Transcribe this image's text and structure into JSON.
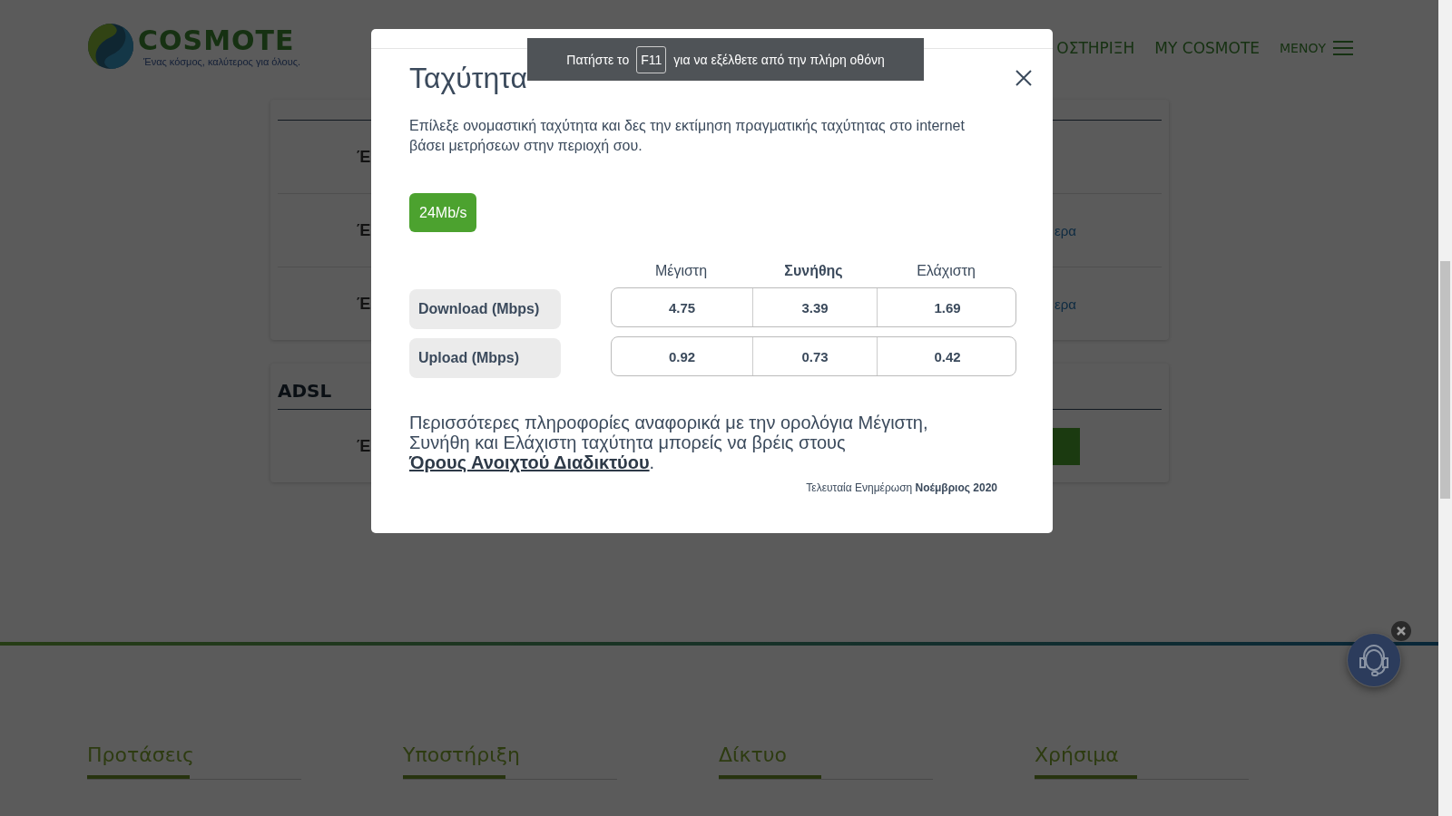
{
  "header": {
    "logo": {
      "name": "COSMOTE",
      "tagline": "Ένας κόσμος, καλύτερος για όλους."
    },
    "nav": [
      {
        "label": "ΟΣΤΗΡΙΞΗ",
        "kind": "link"
      },
      {
        "label": "MY COSMOTE",
        "kind": "link"
      },
      {
        "label": "ΜΕΝΟΥ",
        "kind": "menu"
      }
    ]
  },
  "sections": [
    {
      "rows": [
        {
          "label": "Έ",
          "kind": "plain"
        },
        {
          "label": "Έ",
          "kind": "link",
          "link": "ερα"
        },
        {
          "label": "Έ",
          "kind": "link",
          "link": "ερα"
        }
      ]
    },
    {
      "title": "ADSL",
      "rows": [
        {
          "label": "Έ",
          "kind": "button"
        }
      ]
    }
  ],
  "modal": {
    "title": "Ταχύτητα",
    "description": "Επίλεξε ονομαστική ταχύτητα και δες την εκτίμηση πραγματικής ταχύτητας στο internet βάσει μετρήσεων στην περιοχή σου.",
    "speed_options": [
      {
        "label": "24Mb/s",
        "selected": true
      }
    ],
    "table": {
      "columns": [
        {
          "label": "Μέγιστη",
          "highlighted": false
        },
        {
          "label": "Συνήθης",
          "highlighted": true
        },
        {
          "label": "Ελάχιστη",
          "highlighted": false
        }
      ],
      "rows": [
        {
          "label": "Download (Mbps)",
          "values": [
            "4.75",
            "3.39",
            "1.69"
          ]
        },
        {
          "label": "Upload (Mbps)",
          "values": [
            "0.92",
            "0.73",
            "0.42"
          ]
        }
      ]
    },
    "note": {
      "text": "Περισσότερες πληροφορίες αναφορικά με την ορολόγια Μέγιστη, Συνήθη και Ελάχιστη ταχύτητα μπορείς να βρέις στους",
      "link": "Όρους Ανοιχτού Διαδικτύου",
      "end": "."
    },
    "updated": "Τελευταία Ενημέρωση **Νοέμβριος 2020**"
  },
  "toast": {
    "before": "Πατήστε το",
    "key": "F11",
    "after": "για να εξέλθετε από την πλήρη οθόνη"
  },
  "footer": {
    "headings": [
      "Προτάσεις",
      "Υποστήριξη",
      "Δίκτυο",
      "Χρήσιμα"
    ]
  }
}
